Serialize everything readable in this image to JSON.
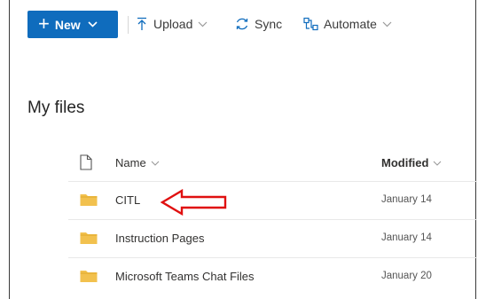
{
  "toolbar": {
    "new_label": "New",
    "upload_label": "Upload",
    "sync_label": "Sync",
    "automate_label": "Automate"
  },
  "page": {
    "title": "My files"
  },
  "table": {
    "headers": {
      "name": "Name",
      "modified": "Modified"
    },
    "rows": [
      {
        "name": "CITL",
        "modified": "January 14",
        "type": "folder"
      },
      {
        "name": "Instruction Pages",
        "modified": "January 14",
        "type": "folder"
      },
      {
        "name": "Microsoft Teams Chat Files",
        "modified": "January 20",
        "type": "folder"
      }
    ]
  },
  "annotation": {
    "arrow_color": "#e01010",
    "points_to": "CITL"
  },
  "colors": {
    "accent": "#0f6cbd",
    "folder": "#f2c14e"
  },
  "icons": [
    "plus-icon",
    "chevron-down-icon",
    "upload-icon",
    "sync-icon",
    "automate-icon",
    "file-icon",
    "folder-icon"
  ]
}
